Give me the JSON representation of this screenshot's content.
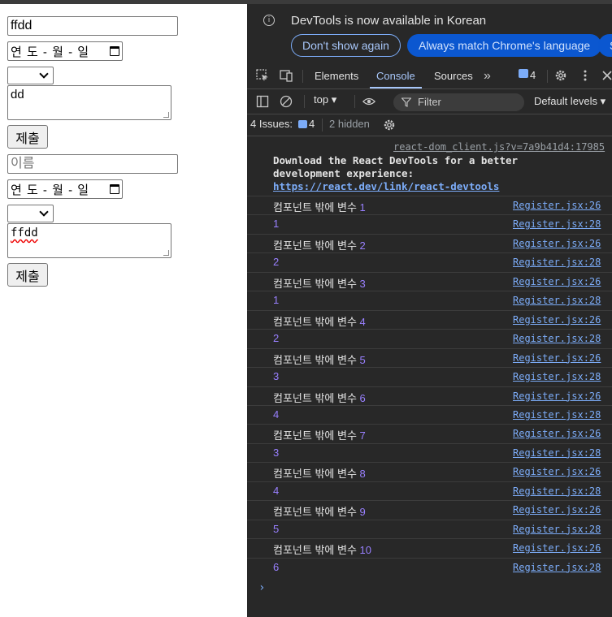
{
  "form": {
    "name1": "ffdd",
    "date1": "연 도 - 월 - 일",
    "textarea1": "dd",
    "submit1": "제출",
    "name_placeholder": "이름",
    "date2": "연 도 - 월 - 일",
    "textarea2": "ffdd",
    "submit2": "제출"
  },
  "devtools": {
    "infobar": {
      "message": "DevTools is now available in Korean",
      "dont_show": "Don't show again",
      "match_language": "Always match Chrome's language",
      "switch_cut": "S"
    },
    "tabs": [
      "Elements",
      "Console",
      "Sources"
    ],
    "active_tab": "Console",
    "message_badge": "4",
    "toolbar": {
      "context": "top",
      "filter_placeholder": "Filter",
      "levels": "Default levels"
    },
    "issues": {
      "label": "4 Issues:",
      "count": "4",
      "hidden": "2 hidden"
    },
    "react_notice": {
      "source": "react-dom_client.js?v=7a9b41d4:17985",
      "text": "Download the React DevTools for a better development experience: ",
      "link": "https://react.dev/link/react-devtools"
    },
    "logs": [
      {
        "text": "컴포넌트 밖에 변수 ",
        "value": "1",
        "source": "Register.jsx:26"
      },
      {
        "text": "",
        "value": "1",
        "source": "Register.jsx:28"
      },
      {
        "text": "컴포넌트 밖에 변수 ",
        "value": "2",
        "source": "Register.jsx:26"
      },
      {
        "text": "",
        "value": "2",
        "source": "Register.jsx:28"
      },
      {
        "text": "컴포넌트 밖에 변수 ",
        "value": "3",
        "source": "Register.jsx:26"
      },
      {
        "text": "",
        "value": "1",
        "source": "Register.jsx:28"
      },
      {
        "text": "컴포넌트 밖에 변수 ",
        "value": "4",
        "source": "Register.jsx:26"
      },
      {
        "text": "",
        "value": "2",
        "source": "Register.jsx:28"
      },
      {
        "text": "컴포넌트 밖에 변수 ",
        "value": "5",
        "source": "Register.jsx:26"
      },
      {
        "text": "",
        "value": "3",
        "source": "Register.jsx:28"
      },
      {
        "text": "컴포넌트 밖에 변수 ",
        "value": "6",
        "source": "Register.jsx:26"
      },
      {
        "text": "",
        "value": "4",
        "source": "Register.jsx:28"
      },
      {
        "text": "컴포넌트 밖에 변수 ",
        "value": "7",
        "source": "Register.jsx:26"
      },
      {
        "text": "",
        "value": "3",
        "source": "Register.jsx:28"
      },
      {
        "text": "컴포넌트 밖에 변수 ",
        "value": "8",
        "source": "Register.jsx:26"
      },
      {
        "text": "",
        "value": "4",
        "source": "Register.jsx:28"
      },
      {
        "text": "컴포넌트 밖에 변수 ",
        "value": "9",
        "source": "Register.jsx:26"
      },
      {
        "text": "",
        "value": "5",
        "source": "Register.jsx:28"
      },
      {
        "text": "컴포넌트 밖에 변수 ",
        "value": "10",
        "source": "Register.jsx:26"
      },
      {
        "text": "",
        "value": "6",
        "source": "Register.jsx:28"
      }
    ],
    "prompt": "›"
  }
}
